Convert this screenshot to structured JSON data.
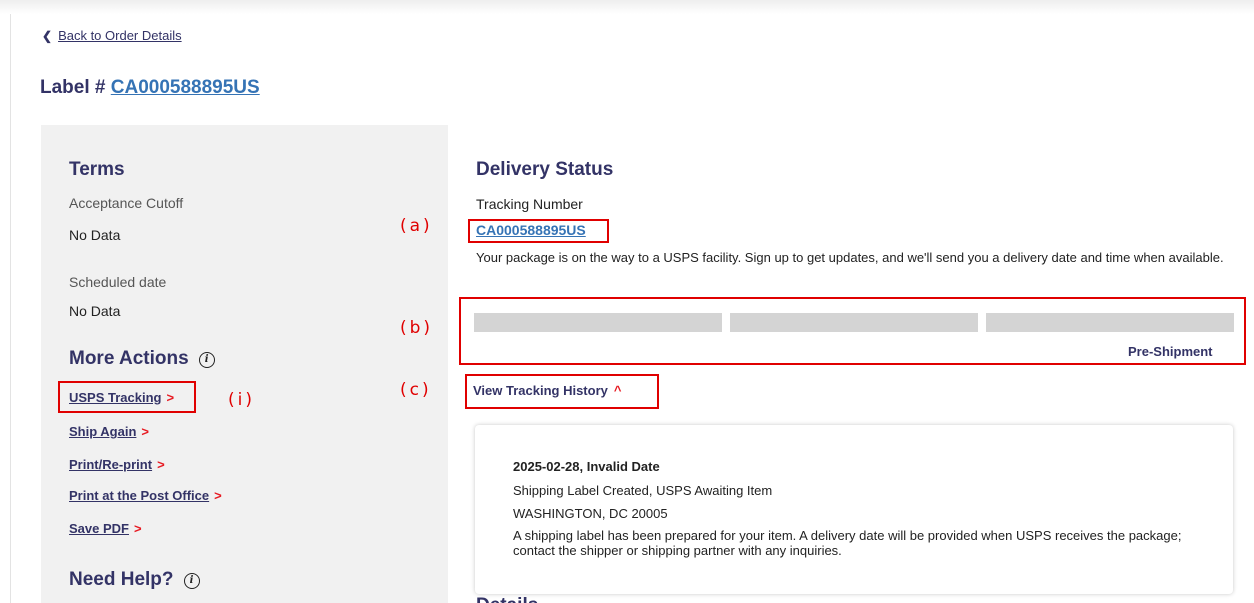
{
  "nav": {
    "back_label": "Back to Order Details"
  },
  "label": {
    "prefix": "Label #",
    "number": "CA000588895US"
  },
  "terms": {
    "heading": "Terms",
    "acceptance_cutoff_label": "Acceptance Cutoff",
    "acceptance_cutoff_value": "No Data",
    "scheduled_date_label": "Scheduled date",
    "scheduled_date_value": "No Data"
  },
  "more_actions": {
    "heading": "More Actions",
    "items": [
      {
        "label": "USPS Tracking"
      },
      {
        "label": "Ship Again"
      },
      {
        "label": "Print/Re-print"
      },
      {
        "label": "Print at the Post Office"
      },
      {
        "label": "Save PDF"
      }
    ]
  },
  "help": {
    "heading": "Need Help?"
  },
  "delivery": {
    "heading": "Delivery Status",
    "tracking_label": "Tracking Number",
    "tracking_number": "CA000588895US",
    "message": "Your package is on the way to a USPS facility. Sign up to get updates, and we'll send you a delivery date and time when available.",
    "progress_status": "Pre-Shipment",
    "progress_segments_filled": 0,
    "progress_segments_total": 3
  },
  "history": {
    "toggle_label": "View Tracking History",
    "events": [
      {
        "date": "2025-02-28, Invalid Date",
        "status": "Shipping Label Created, USPS Awaiting Item",
        "location": "WASHINGTON, DC 20005",
        "description": "A shipping label has been prepared for your item. A delivery date will be provided when USPS receives the package; contact the shipper or shipping partner with any inquiries."
      }
    ]
  },
  "details": {
    "heading": "Details"
  },
  "annotations": {
    "a": "(a)",
    "b": "(b)",
    "c": "(c)",
    "i": "(i)"
  },
  "colors": {
    "navy": "#333366",
    "link_blue": "#3573b5",
    "usps_red": "#e71921",
    "annotation_red": "#e00000"
  }
}
